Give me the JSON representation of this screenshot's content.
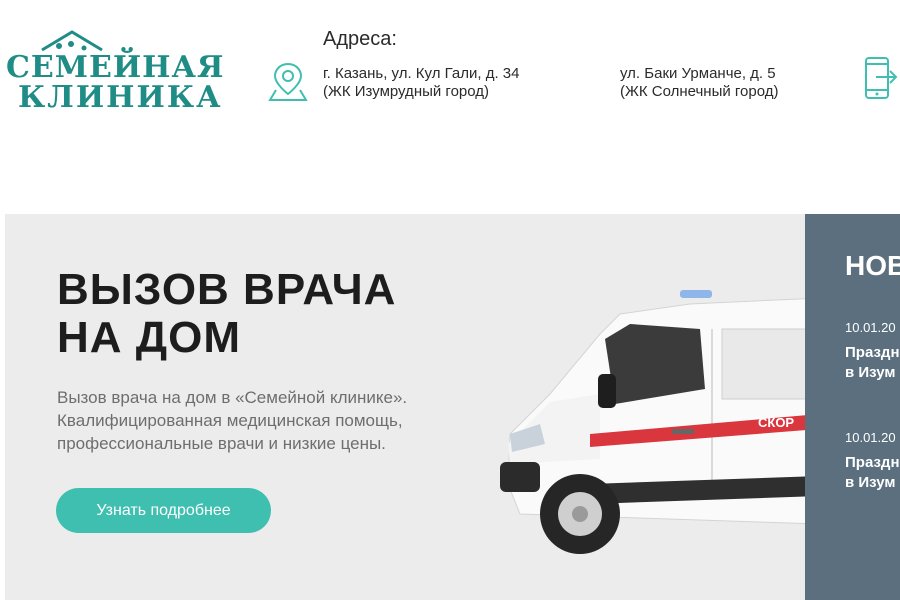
{
  "header": {
    "logo": {
      "line1": "СЕМЕЙНАЯ",
      "line2": "КЛИНИКА"
    },
    "addresses_title": "Адреса:",
    "address1": {
      "line1": "г. Казань, ул. Кул Гали, д. 34",
      "line2": "(ЖК Изумрудный город)"
    },
    "address2": {
      "line1": "ул. Баки Урманче, д. 5",
      "line2": "(ЖК Солнечный город)"
    },
    "icons": {
      "location": "location-pin-icon",
      "phone": "phone-call-icon"
    }
  },
  "hero": {
    "title_line1": "ВЫЗОВ ВРАЧА",
    "title_line2": "НА ДОМ",
    "desc_line1": "Вызов врача на дом в «Семейной клинике».",
    "desc_line2": "Квалифицированная медицинская помощь,",
    "desc_line3": "профессиональные врачи и низкие цены.",
    "button_label": "Узнать подробнее",
    "van_text": "СКОР"
  },
  "news": {
    "title": "НОВ",
    "items": [
      {
        "date": "10.01.20",
        "title_line1": "Праздн",
        "title_line2": "в Изум"
      },
      {
        "date": "10.01.20",
        "title_line1": "Праздн",
        "title_line2": "в Изум"
      }
    ]
  },
  "colors": {
    "brand": "#1f8c86",
    "button": "#3fbfb0",
    "hero_bg": "#ececec",
    "news_bg": "#5b6f7e"
  }
}
